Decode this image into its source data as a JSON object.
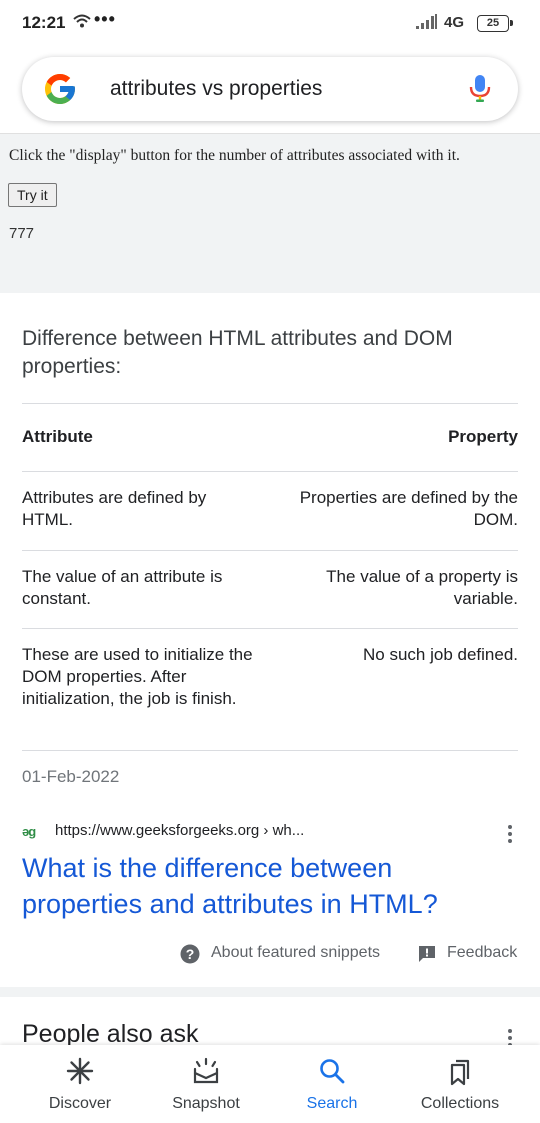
{
  "status_bar": {
    "time": "12:21",
    "dots": "•••",
    "network": "4G",
    "battery": "25"
  },
  "search": {
    "query": "attributes vs properties"
  },
  "demo": {
    "instruction": "Click the \"display\" button for the number of attributes associated with it.",
    "button_label": "Try it",
    "output": "777"
  },
  "snippet": {
    "title": "Difference between HTML attributes and DOM properties:",
    "table": {
      "headers": [
        "Attribute",
        "Property"
      ],
      "rows": [
        [
          "Attributes are defined by HTML.",
          "Properties are defined by the DOM."
        ],
        [
          "The value of an attribute is constant.",
          "The value of a property is variable."
        ],
        [
          "These are used to initialize the DOM properties. After initialization, the job is finish.",
          "No such job defined."
        ]
      ]
    },
    "date": "01-Feb-2022"
  },
  "source": {
    "icon_text": "ǝɡ",
    "url": "https://www.geeksforgeeks.org › wh...",
    "link_title": "What is the difference between properties and attributes in HTML?"
  },
  "snippet_footer": {
    "about_label": "About featured snippets",
    "feedback_label": "Feedback"
  },
  "people_also_ask": {
    "title": "People also ask"
  },
  "bottom_nav": {
    "items": [
      {
        "label": "Discover",
        "icon": "asterisk-icon"
      },
      {
        "label": "Snapshot",
        "icon": "snapshot-tray-icon"
      },
      {
        "label": "Search",
        "icon": "search-icon",
        "active": true
      },
      {
        "label": "Collections",
        "icon": "bookmarks-icon"
      }
    ]
  },
  "colors": {
    "link": "#1558d6",
    "accent": "#1a73e8",
    "gfg_green": "#2f8d46"
  }
}
